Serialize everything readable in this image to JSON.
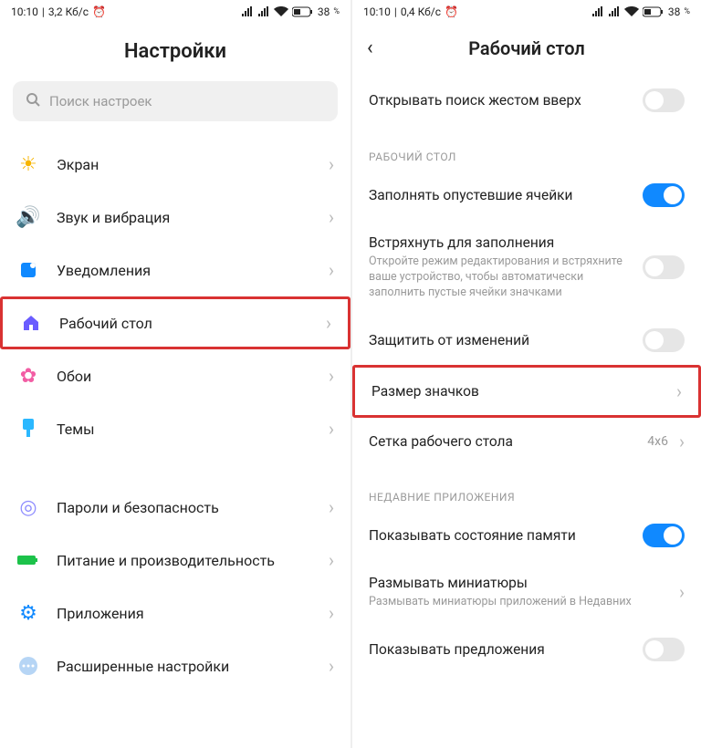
{
  "left": {
    "status": {
      "time": "10:10",
      "speed": "3,2 Кб/с",
      "battery": "38"
    },
    "title": "Настройки",
    "search_placeholder": "Поиск настроек",
    "items": [
      {
        "icon": "sun",
        "color": "#f7b500",
        "label": "Экран"
      },
      {
        "icon": "sound",
        "color": "#1cc24a",
        "label": "Звук и вибрация"
      },
      {
        "icon": "notify",
        "color": "#1089ff",
        "label": "Уведомления"
      },
      {
        "icon": "home",
        "color": "#6a5cff",
        "label": "Рабочий стол"
      },
      {
        "icon": "flower",
        "color": "#f25da4",
        "label": "Обои"
      },
      {
        "icon": "brush",
        "color": "#2bb8ff",
        "label": "Темы"
      }
    ],
    "items2": [
      {
        "icon": "lock",
        "color": "#8e8cff",
        "label": "Пароли и безопасность"
      },
      {
        "icon": "battery",
        "color": "#1cc24a",
        "label": "Питание и производительность"
      },
      {
        "icon": "apps",
        "color": "#1089ff",
        "label": "Приложения"
      },
      {
        "icon": "more",
        "color": "#b6d5f5",
        "label": "Расширенные настройки"
      }
    ]
  },
  "right": {
    "status": {
      "time": "10:10",
      "speed": "0,4 Кб/с",
      "battery": "38"
    },
    "title": "Рабочий стол",
    "rows": {
      "open_search": "Открывать поиск жестом вверх",
      "section1": "РАБОЧИЙ СТОЛ",
      "fill_empty": "Заполнять опустевшие ячейки",
      "shake": "Встряхнуть для заполнения",
      "shake_sub": "Откройте режим редактирования и встряхните ваше устройство, чтобы автоматически заполнить пустые ячейки значками",
      "protect": "Защитить от изменений",
      "icon_size": "Размер значков",
      "grid": "Сетка рабочего стола",
      "grid_val": "4x6",
      "section2": "НЕДАВНИЕ ПРИЛОЖЕНИЯ",
      "mem_state": "Показывать состояние памяти",
      "blur": "Размывать миниатюры",
      "blur_sub": "Размывать миниатюры приложений в Недавних",
      "suggest": "Показывать предложения"
    }
  }
}
